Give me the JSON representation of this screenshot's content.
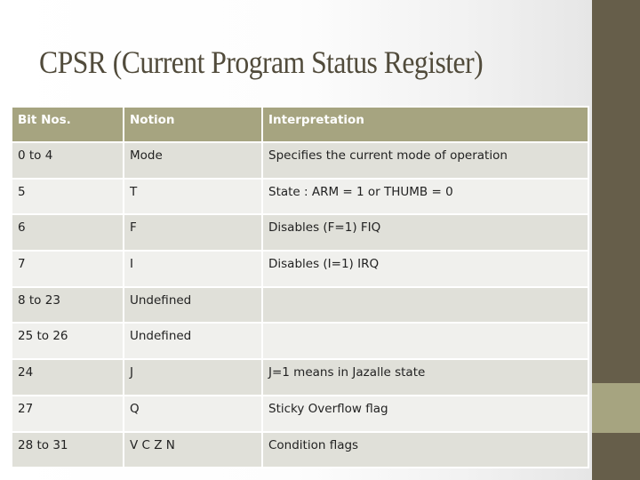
{
  "slide": {
    "title": "CPSR (Current Program Status Register)",
    "colors": {
      "title": "#514b3b",
      "sidebar": "#665e4a",
      "sidebar_band": "#a6a480",
      "header_bg": "#a6a480",
      "row_dark": "#e0e0d9",
      "row_light": "#f0f0ed"
    }
  },
  "table": {
    "headers": [
      "Bit Nos.",
      "Notion",
      "Interpretation"
    ],
    "rows": [
      {
        "bits": "0 to 4",
        "notion": "Mode",
        "interpretation": "Specifies the current mode of operation"
      },
      {
        "bits": "5",
        "notion": "T",
        "interpretation": "State : ARM = 1 or THUMB = 0"
      },
      {
        "bits": "6",
        "notion": "F",
        "interpretation": "Disables (F=1) FIQ"
      },
      {
        "bits": "7",
        "notion": "I",
        "interpretation": "Disables (I=1) IRQ"
      },
      {
        "bits": "8 to 23",
        "notion": "Undefined",
        "interpretation": ""
      },
      {
        "bits": "25 to 26",
        "notion": "Undefined",
        "interpretation": ""
      },
      {
        "bits": "24",
        "notion": "J",
        "interpretation": "J=1 means in Jazalle state"
      },
      {
        "bits": "27",
        "notion": "Q",
        "interpretation": "Sticky Overflow flag"
      },
      {
        "bits": "28 to 31",
        "notion": "V C Z N",
        "interpretation": "Condition flags"
      }
    ]
  }
}
